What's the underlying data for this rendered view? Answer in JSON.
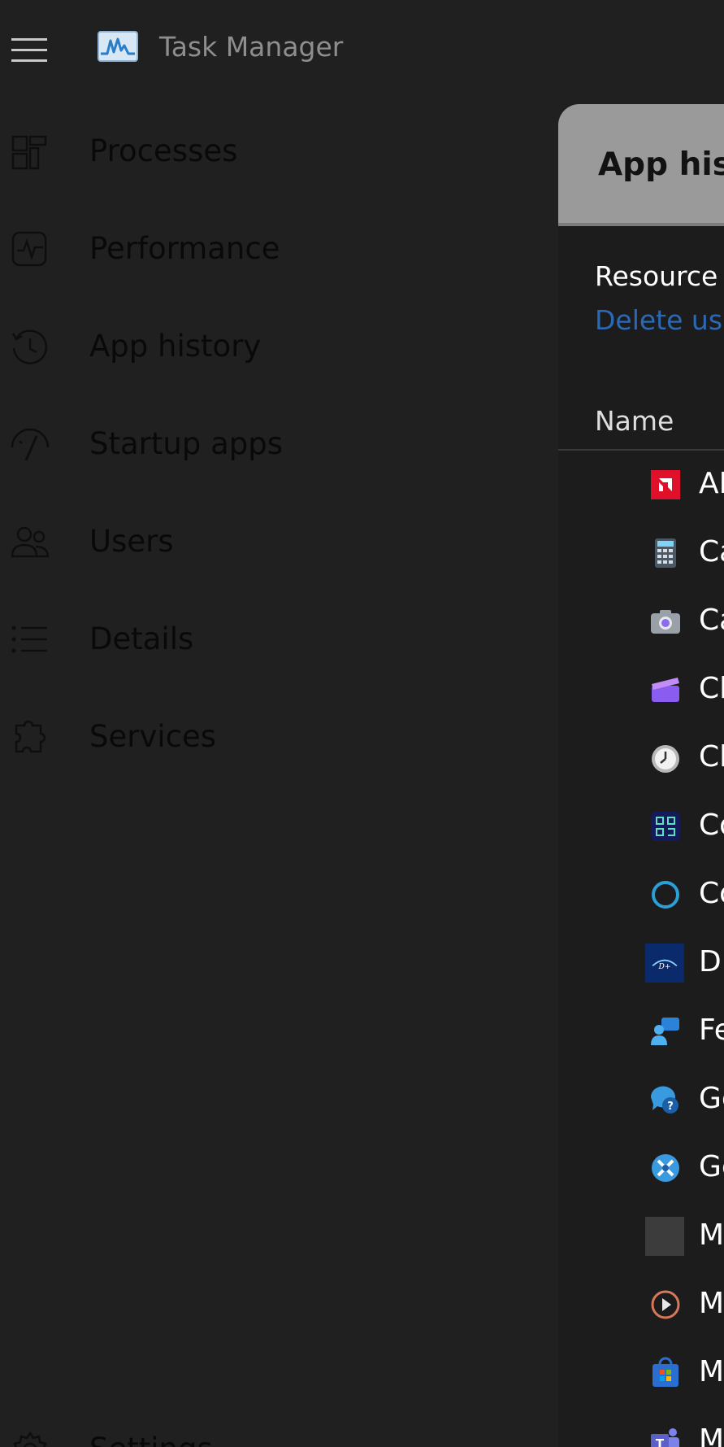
{
  "titlebar": {
    "title": "Task Manager",
    "menu_icon": "hamburger-menu-icon",
    "logo_icon": "task-manager-logo-icon"
  },
  "sidebar": {
    "items": [
      {
        "label": "Processes",
        "icon": "processes-icon"
      },
      {
        "label": "Performance",
        "icon": "performance-icon"
      },
      {
        "label": "App history",
        "icon": "history-icon"
      },
      {
        "label": "Startup apps",
        "icon": "startup-gauge-icon"
      },
      {
        "label": "Users",
        "icon": "users-icon"
      },
      {
        "label": "Details",
        "icon": "details-list-icon"
      },
      {
        "label": "Services",
        "icon": "services-puzzle-icon"
      }
    ],
    "settings": {
      "label": "Settings",
      "icon": "gear-icon"
    }
  },
  "main": {
    "title": "App hist",
    "resource_text": "Resource u",
    "delete_link": "Delete usa",
    "column_name": "Name",
    "rows": [
      {
        "label": "AI",
        "icon": "amd-icon",
        "color": "#e0102b"
      },
      {
        "label": "Ca",
        "icon": "calculator-icon",
        "color": "#5f7f99"
      },
      {
        "label": "Ca",
        "icon": "camera-icon",
        "color": "#9aa0a8"
      },
      {
        "label": "Cl",
        "icon": "clipchamp-icon",
        "color": "#8a5cf0"
      },
      {
        "label": "Cl",
        "icon": "clock-icon",
        "color": "#d9d9d9"
      },
      {
        "label": "Co",
        "icon": "code-reader-icon",
        "color": "#1f2a6e"
      },
      {
        "label": "Co",
        "icon": "cortana-ring-icon",
        "color": "#2a9fd8"
      },
      {
        "label": "Di",
        "icon": "disney-plus-icon",
        "color": "#0b2a6b"
      },
      {
        "label": "Fe",
        "icon": "feedback-hub-icon",
        "color": "#2a83d8"
      },
      {
        "label": "Ge",
        "icon": "get-help-icon",
        "color": "#3a9ae0"
      },
      {
        "label": "Ge",
        "icon": "get-started-icon",
        "color": "#3a9ae0"
      },
      {
        "label": "M",
        "icon": "blank-app-icon",
        "color": "#3c3c3c"
      },
      {
        "label": "M",
        "icon": "media-player-icon",
        "color": "#e0783a"
      },
      {
        "label": "M",
        "icon": "microsoft-store-icon",
        "color": "#2a6fd0"
      },
      {
        "label": "M",
        "icon": "teams-icon",
        "color": "#5b5fc7"
      }
    ]
  }
}
